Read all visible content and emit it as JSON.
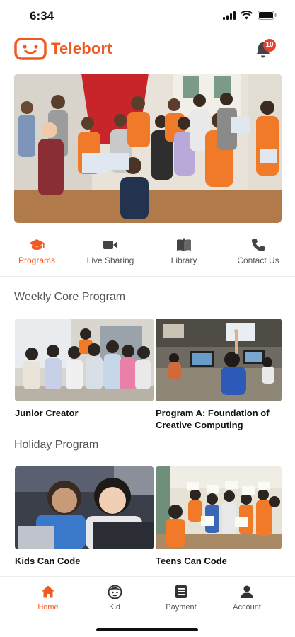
{
  "status_bar": {
    "time": "6:34",
    "icons": [
      "signal-icon",
      "wifi-icon",
      "battery-icon"
    ]
  },
  "header": {
    "app_name": "Telebort",
    "notification_count": "10",
    "brand_color": "#f05a22"
  },
  "hero": {
    "image": "group-photo-students"
  },
  "quick_nav": [
    {
      "label": "Programs",
      "icon": "graduation-cap-icon",
      "active": true
    },
    {
      "label": "Live Sharing",
      "icon": "video-camera-icon",
      "active": false
    },
    {
      "label": "Library",
      "icon": "book-icon",
      "active": false
    },
    {
      "label": "Contact Us",
      "icon": "phone-icon",
      "active": false
    }
  ],
  "weekly": {
    "title": "Weekly Core Program",
    "cards": [
      {
        "title": "Junior Creator",
        "image": "kids-group-photo"
      },
      {
        "title": "Program A: Foundation of Creative Computing",
        "image": "computer-lab-photo"
      }
    ]
  },
  "holiday": {
    "title": "Holiday Program",
    "cards": [
      {
        "title": "Kids Can Code",
        "image": "girls-laptop-photo"
      },
      {
        "title": "Teens Can Code",
        "image": "teens-certificates-photo"
      }
    ]
  },
  "bottom_nav": [
    {
      "label": "Home",
      "icon": "home-icon",
      "active": true
    },
    {
      "label": "Kid",
      "icon": "kid-face-icon",
      "active": false
    },
    {
      "label": "Payment",
      "icon": "receipt-icon",
      "active": false
    },
    {
      "label": "Account",
      "icon": "person-icon",
      "active": false
    }
  ]
}
